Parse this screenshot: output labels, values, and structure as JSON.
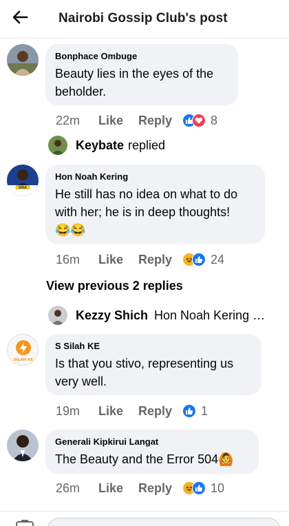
{
  "header": {
    "title": "Nairobi Gossip Club's post"
  },
  "comments": [
    {
      "author": "Bonphace Ombuge",
      "text": "Beauty lies in the eyes of the beholder.",
      "time": "22m",
      "like_label": "Like",
      "reply_label": "Reply",
      "reaction_icons": [
        "like-icon",
        "love-icon"
      ],
      "reaction_count": "8"
    },
    {
      "author": "Hon Noah Kering",
      "text": "He still has no idea on what to do with her; he is in deep thoughts!",
      "emojis": "😂😂",
      "time": "16m",
      "like_label": "Like",
      "reply_label": "Reply",
      "reaction_icons": [
        "haha-icon",
        "like-icon"
      ],
      "reaction_count": "24"
    },
    {
      "author": "S Silah KE",
      "text": "Is that you stivo, representing us very well.",
      "time": "19m",
      "like_label": "Like",
      "reply_label": "Reply",
      "reaction_icons": [
        "like-icon"
      ],
      "reaction_count": "1"
    },
    {
      "author": "Generali Kipkirui Langat",
      "text": "The Beauty and the Error 504",
      "emojis": "🙆",
      "time": "26m",
      "like_label": "Like",
      "reply_label": "Reply",
      "reaction_icons": [
        "haha-icon",
        "like-icon"
      ],
      "reaction_count": "10"
    }
  ],
  "replied": {
    "name": "Keybate",
    "verb": "replied"
  },
  "view_previous": "View previous 2 replies",
  "reply_preview": {
    "name": "Kezzy Shich",
    "text": "Hon Noah Kering …"
  },
  "avatar_badges": {
    "silah": "SILAH KE",
    "uda": "UDA"
  },
  "colors": {
    "accent": "#1877f2",
    "bubble": "#f0f2f5",
    "muted": "#65676b"
  }
}
